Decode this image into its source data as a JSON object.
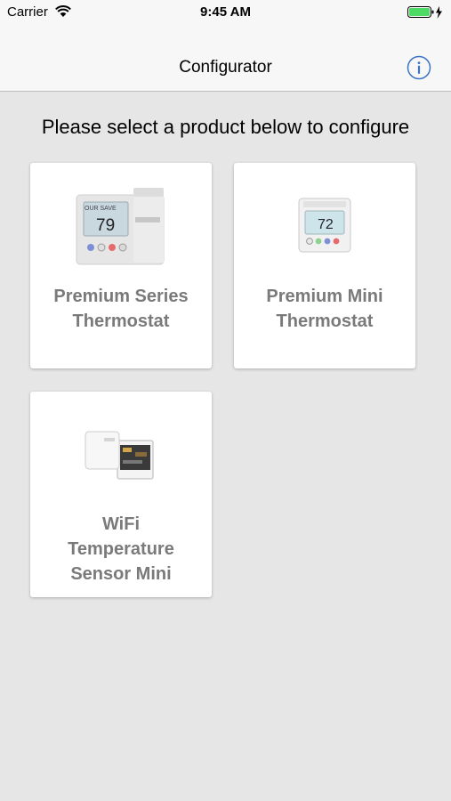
{
  "status_bar": {
    "carrier": "Carrier",
    "time": "9:45 AM",
    "wifi_icon": "wifi-icon",
    "battery_icon": "battery-charging-icon",
    "battery_color": "#4cd964"
  },
  "nav": {
    "title": "Configurator",
    "info_icon": "info-icon",
    "accent_color": "#3b74c4"
  },
  "prompt": "Please select a product below to configure",
  "products": [
    {
      "label_lines": [
        "Premium Series",
        "Thermostat"
      ],
      "image_icon": "thermostat-premium-series-image",
      "display_value": "79"
    },
    {
      "label_lines": [
        "Premium Mini",
        "Thermostat"
      ],
      "image_icon": "thermostat-premium-mini-image",
      "display_value": "72"
    },
    {
      "label_lines": [
        "WiFi",
        "Temperature",
        "Sensor Mini"
      ],
      "image_icon": "wifi-temperature-sensor-image"
    }
  ]
}
